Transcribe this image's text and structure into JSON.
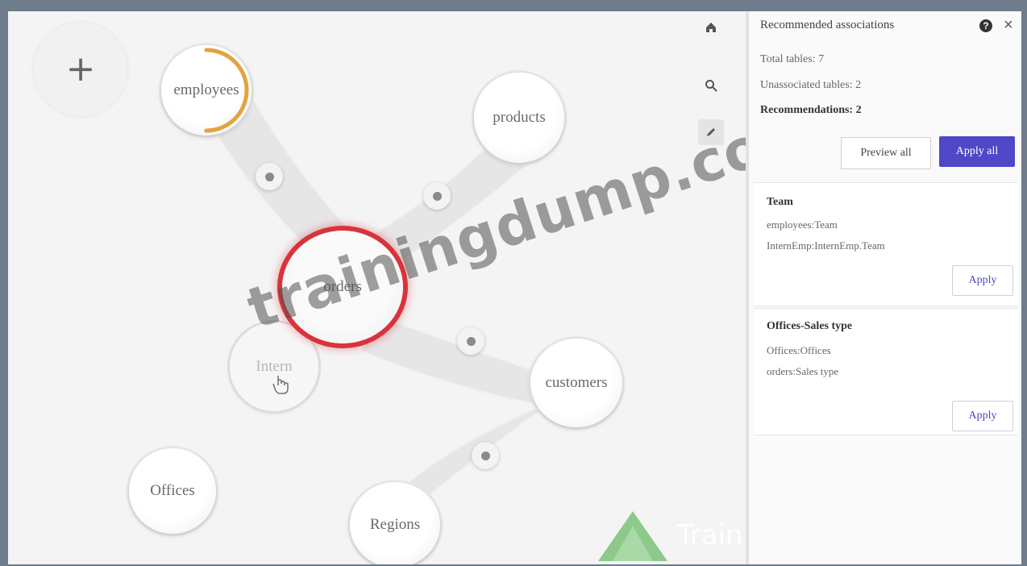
{
  "canvas": {
    "add_button": "+",
    "nodes": {
      "employees": "employees",
      "products": "products",
      "orders": "orders",
      "inter": "Intern",
      "customers": "customers",
      "offices": "Offices",
      "regions": "Regions"
    },
    "employees_progress_fraction": 0.5
  },
  "toolbar": {
    "items": [
      {
        "icon": "home-icon",
        "glyph": "⌂"
      },
      {
        "icon": "search-icon",
        "glyph": "⚲"
      },
      {
        "icon": "edit-icon",
        "glyph": "✎"
      }
    ]
  },
  "panel": {
    "title": "Recommended associations",
    "total_tables": "Total tables: 7",
    "unassociated_tables": "Unassociated tables: 2",
    "recommendations": "Recommendations: 2",
    "preview_all": "Preview all",
    "apply_all": "Apply all",
    "cards": [
      {
        "title": "Team",
        "lines": [
          "employees:Team",
          "InternEmp:InternEmp.Team"
        ],
        "apply": "Apply"
      },
      {
        "title": "Offices-Sales type",
        "lines": [
          "Offices:Offices",
          "orders:Sales type"
        ],
        "apply": "Apply"
      }
    ]
  },
  "watermark": "trainingdump.com",
  "logo_text": "Train",
  "colors": {
    "accent": "#4e48c9",
    "selected_ring": "#d8333d",
    "progress": "#e2a33f"
  }
}
